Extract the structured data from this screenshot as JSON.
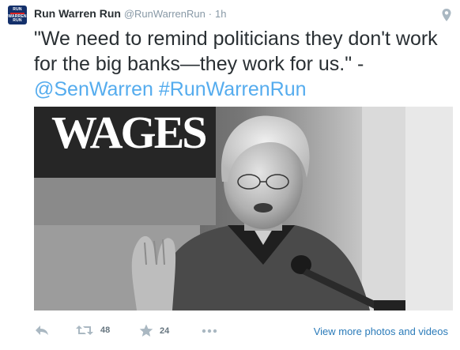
{
  "tweet": {
    "author_name": "Run Warren Run",
    "handle": "@RunWarrenRun",
    "separator": "·",
    "time": "1h",
    "avatar_text_top": "RUN",
    "avatar_text_mid": "WARREN",
    "avatar_text_bottom": "RUN",
    "text_main": "\"We need to remind politicians they don't work for the big banks—they work for us.\" -",
    "mention": "@SenWarren",
    "hashtag": "#RunWarrenRun",
    "photo_sign_text": "WAGES"
  },
  "actions": {
    "retweet_count": "48",
    "favorite_count": "24",
    "view_more_label": "View more photos and videos"
  },
  "icons": {
    "location": "map-pin-icon",
    "reply": "reply-icon",
    "retweet": "retweet-icon",
    "favorite": "star-icon",
    "more": "more-dots-icon"
  },
  "colors": {
    "link": "#55acee",
    "view_more": "#2b7bb9",
    "muted": "#8899a6",
    "icon": "#aab8c2"
  }
}
